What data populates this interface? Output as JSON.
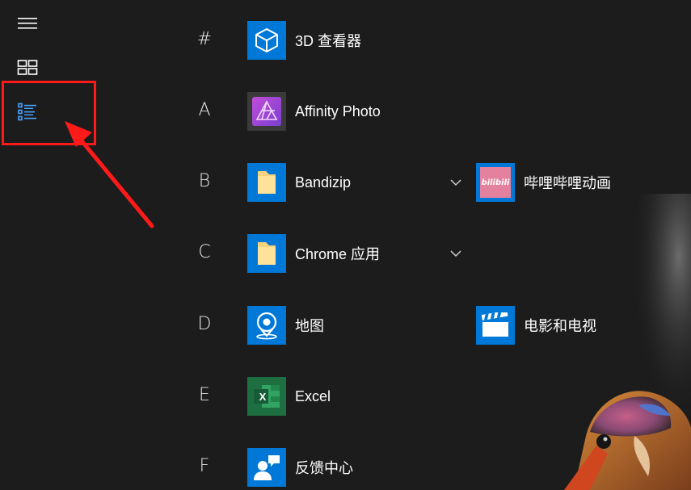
{
  "rail": {
    "items": [
      {
        "icon": "hamburger-menu-icon"
      },
      {
        "icon": "tiles-grid-icon"
      },
      {
        "icon": "all-apps-list-icon",
        "active": true
      }
    ]
  },
  "annotation": {
    "highlight_color": "#ff1a1a"
  },
  "apps": {
    "letters": [
      "#",
      "A",
      "B",
      "C",
      "D",
      "E",
      "F"
    ],
    "viewer3d": {
      "label": "3D 查看器",
      "tile_color": "#0078d7"
    },
    "affinity": {
      "label": "Affinity Photo",
      "tile_color": "#3a3a3a"
    },
    "bandizip": {
      "label": "Bandizip",
      "tile_color": "#0078d7"
    },
    "bilibili": {
      "label": "哔哩哔哩动画",
      "tile_color": "#0078d7",
      "logo_text": "bilibili"
    },
    "chrome_apps": {
      "label": "Chrome 应用",
      "tile_color": "#0078d7"
    },
    "maps": {
      "label": "地图",
      "tile_color": "#0078d7"
    },
    "movies": {
      "label": "电影和电视",
      "tile_color": "#0078d7"
    },
    "excel": {
      "label": "Excel",
      "tile_color": "#1d6f42",
      "logo_letter": "X"
    },
    "feedback": {
      "label": "反馈中心",
      "tile_color": "#0078d7"
    }
  }
}
